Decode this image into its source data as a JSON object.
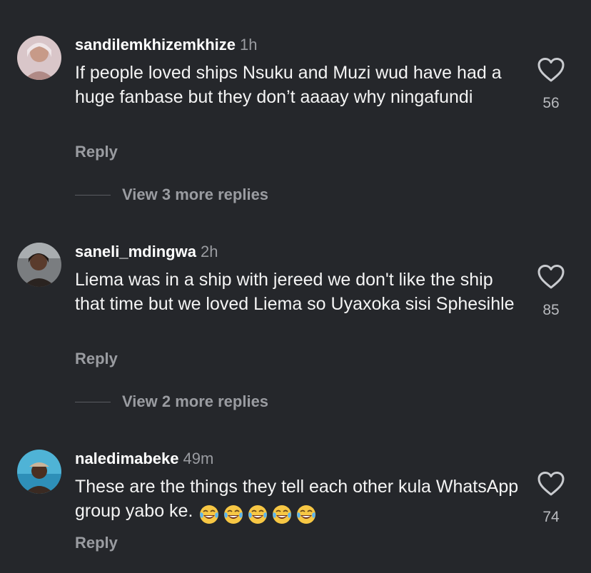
{
  "comments": [
    {
      "username": "sandilemkhizemkhize",
      "time": "1h",
      "text": "If people loved ships Nsuku and Muzi wud have had a huge fanbase but they don’t aaaay why ningafundi",
      "reply_label": "Reply",
      "view_replies": "View 3 more replies",
      "likes": "56"
    },
    {
      "username": "saneli_mdingwa",
      "time": "2h",
      "text": "Liema was in a ship with jereed we don't like the ship that time but we loved Liema so Uyaxoka sisi Sphesihle",
      "reply_label": "Reply",
      "view_replies": "View 2 more replies",
      "likes": "85"
    },
    {
      "username": "naledimabeke",
      "time": "49m",
      "text": "These are the things they tell each other kula WhatsApp group yabo ke.",
      "emojis": "😂😂😂😂😂",
      "reply_label": "Reply",
      "likes": "74"
    }
  ],
  "colors": {
    "background": "#25272b",
    "muted_text": "#9a9ca1",
    "primary_text": "#f4f4f4"
  },
  "icons": [
    "heart-outline-icon",
    "tears-of-joy-emoji"
  ]
}
